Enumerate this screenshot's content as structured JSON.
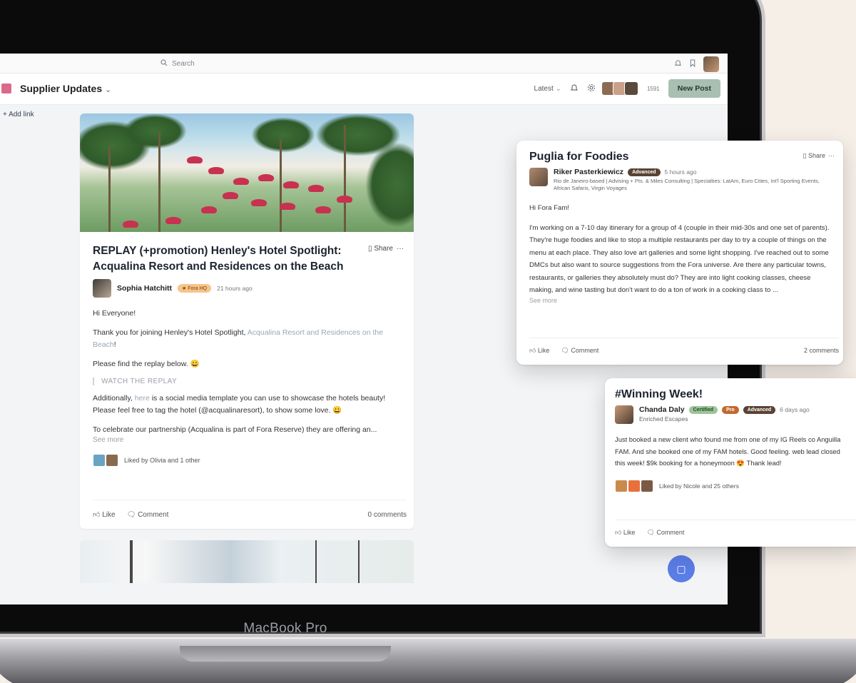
{
  "device": {
    "label": "MacBook Pro"
  },
  "topbar": {
    "search_placeholder": "Search"
  },
  "channel": {
    "title": "Supplier Updates",
    "sort_label": "Latest",
    "member_count": "1591",
    "new_post_label": "New Post",
    "add_link_label": "Add link"
  },
  "main_post": {
    "title": "REPLAY (+promotion) Henley's Hotel Spotlight: Acqualina Resort and Residences on the Beach",
    "share_label": "Share",
    "author": "Sophia Hatchitt",
    "badge": "Fora HQ",
    "time": "21 hours ago",
    "greeting": "Hi Everyone!",
    "p1_prefix": "Thank you for joining Henley's Hotel Spotlight, ",
    "p1_link": "Acqualina Resort and Residences on the Beach",
    "p1_suffix": "!",
    "p2": "Please find the replay below. 😀",
    "watch_label": "WATCH THE REPLAY",
    "p3_prefix": "Additionally, ",
    "p3_link": "here",
    "p3_suffix": " is a social media template you can use to showcase the hotels beauty! Please feel free to tag the hotel (@acqualinaresort), to show some love. 😀",
    "p4": "To celebrate our partnership (Acqualina is part of Fora Reserve) they are offering an...",
    "see_more": "See more",
    "liked_by": "Liked by Olivia and 1 other",
    "like_label": "Like",
    "comment_label": "Comment",
    "comments_count": "0 comments"
  },
  "puglia_post": {
    "title": "Puglia for Foodies",
    "share_label": "Share",
    "author": "Riker Pasterkiewicz",
    "badge": "Advanced",
    "time": "5 hours ago",
    "bio": "Rio de Janeiro-based | Advising + Pts. & Miles Consulting | Specialties: LatAm, Euro Cities, Int'l Sporting Events, African Safaris, Virgin Voyages",
    "greeting": "Hi Fora Fam!",
    "body": "I'm working on a 7-10 day itinerary for a group of 4 (couple in their mid-30s and one set of parents). They're huge foodies and like to stop a multiple restaurants per day to try a couple of things on the menu at each place. They also love art galleries and some light shopping. I've reached out to some DMCs but also want to source suggestions from the Fora universe. Are there any particular towns, restaurants, or galleries they absolutely must do? They are into light cooking classes, cheese making, and wine tasting but don't want to do a ton of work in a cooking class to ...",
    "see_more": "See more",
    "like_label": "Like",
    "comment_label": "Comment",
    "comments_count": "2 comments"
  },
  "winning_post": {
    "title": "#Winning Week!",
    "author": "Chanda Daly",
    "badges": [
      "Certified",
      "Pro",
      "Advanced"
    ],
    "time": "6 days ago",
    "subtitle": "Enriched Escapes",
    "body": "Just booked a new client who found me from one of my IG Reels co Anguilla FAM. And she booked one of my FAM hotels. Good feeling. web lead closed this week! $9k booking for a honeymoon 😍 Thank lead!",
    "liked_by": "Liked by Nicole and 25 others",
    "like_label": "Like",
    "comment_label": "Comment"
  }
}
